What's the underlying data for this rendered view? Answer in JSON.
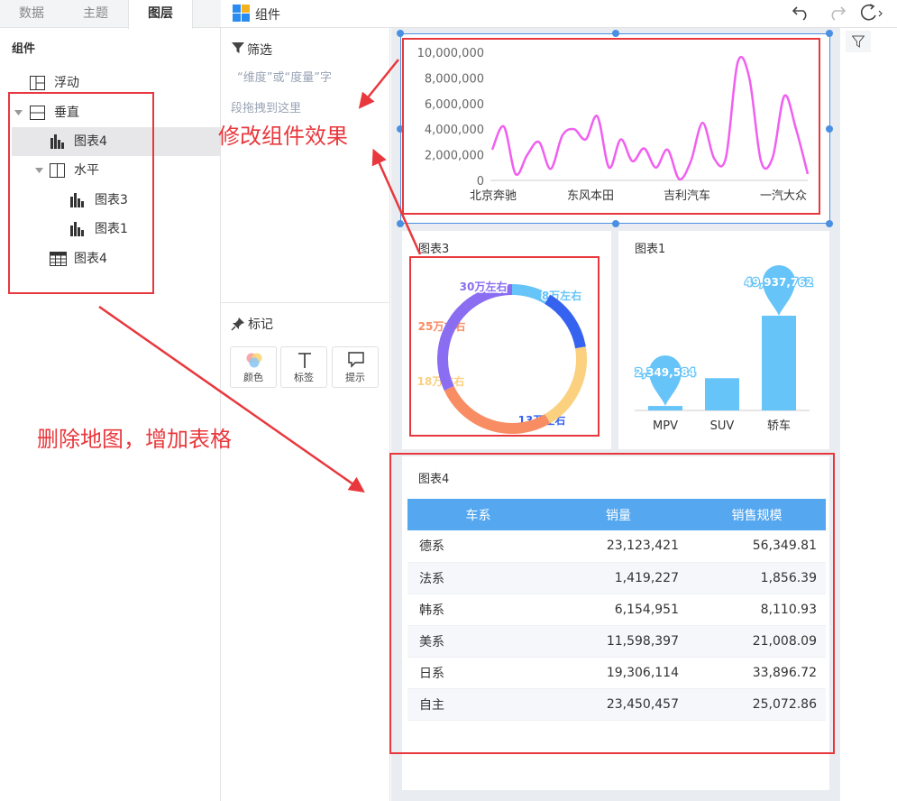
{
  "left_panel": {
    "tabs": [
      "数据",
      "主题",
      "图层"
    ],
    "active_tab": "图层",
    "section_title": "组件",
    "tree": [
      {
        "label": "浮动",
        "icon": "float-layout-icon"
      },
      {
        "label": "垂直",
        "icon": "vertical-layout-icon"
      },
      {
        "label": "图表4",
        "icon": "bar-chart-icon"
      },
      {
        "label": "水平",
        "icon": "horizontal-layout-icon"
      },
      {
        "label": "图表3",
        "icon": "bar-chart-icon"
      },
      {
        "label": "图表1",
        "icon": "bar-chart-icon"
      },
      {
        "label": "图表4",
        "icon": "table-icon"
      }
    ]
  },
  "toolbar": {
    "title": "组件",
    "icons": [
      "undo-icon",
      "redo-icon",
      "refresh-icon"
    ]
  },
  "filter": {
    "title": "筛选",
    "hint_line1": "“维度”或“度量”字",
    "hint_line2": "段拖拽到这里"
  },
  "marks": {
    "title": "标记",
    "buttons": [
      {
        "label": "颜色",
        "icon": "color-icon"
      },
      {
        "label": "标签",
        "icon": "text-icon"
      },
      {
        "label": "提示",
        "icon": "tooltip-icon"
      }
    ]
  },
  "annotations": {
    "modify": "修改组件效果",
    "delete": "删除地图，增加表格",
    "color": "#e8383d"
  },
  "colors": {
    "line": "#f05ff0",
    "bar": "#66c4f9",
    "table_header": "#55a8f0",
    "selection": "#4a90e2"
  },
  "chart_data": [
    {
      "type": "line",
      "x": [
        "北京奔驰",
        "东风本田",
        "吉利汽车",
        "一汽大众"
      ],
      "yticks": [
        "0",
        "2,000,000",
        "4,000,000",
        "6,000,000",
        "8,000,000",
        "10,000,000"
      ],
      "ylim": [
        0,
        10000000
      ],
      "values": [
        2400000,
        4200000,
        500000,
        2000000,
        3000000,
        900000,
        3500000,
        4000000,
        3200000,
        5000000,
        1000000,
        3200000,
        1500000,
        2500000,
        1000000,
        2400000,
        100000,
        1500000,
        4500000,
        1700000,
        1800000,
        9200000,
        8000000,
        1500000,
        1800000,
        6600000,
        4000000,
        500000
      ],
      "color": "#f05ff0"
    },
    {
      "type": "pie",
      "title": "图表3",
      "labels": [
        "8万左右",
        "13万左右",
        "18万左右",
        "25万左右",
        "30万左右"
      ],
      "values": [
        8,
        13,
        18,
        25,
        30
      ],
      "colors": [
        "#66c4f9",
        "#3563f0",
        "#fbd07f",
        "#f88c62",
        "#8a6df0"
      ]
    },
    {
      "type": "bar",
      "title": "图表1",
      "categories": [
        "MPV",
        "SUV",
        "轿车"
      ],
      "values": [
        2349584,
        17000000,
        49937762
      ],
      "labels": [
        "2,349,584",
        "",
        "49,937,762"
      ],
      "color": "#66c4f9"
    }
  ],
  "table": {
    "title": "图表4",
    "headers": [
      "车系",
      "销量",
      "销售规模"
    ],
    "rows": [
      [
        "德系",
        "23,123,421",
        "56,349.81"
      ],
      [
        "法系",
        "1,419,227",
        "1,856.39"
      ],
      [
        "韩系",
        "6,154,951",
        "8,110.93"
      ],
      [
        "美系",
        "11,598,397",
        "21,008.09"
      ],
      [
        "日系",
        "19,306,114",
        "33,896.72"
      ],
      [
        "自主",
        "23,450,457",
        "25,072.86"
      ]
    ]
  }
}
